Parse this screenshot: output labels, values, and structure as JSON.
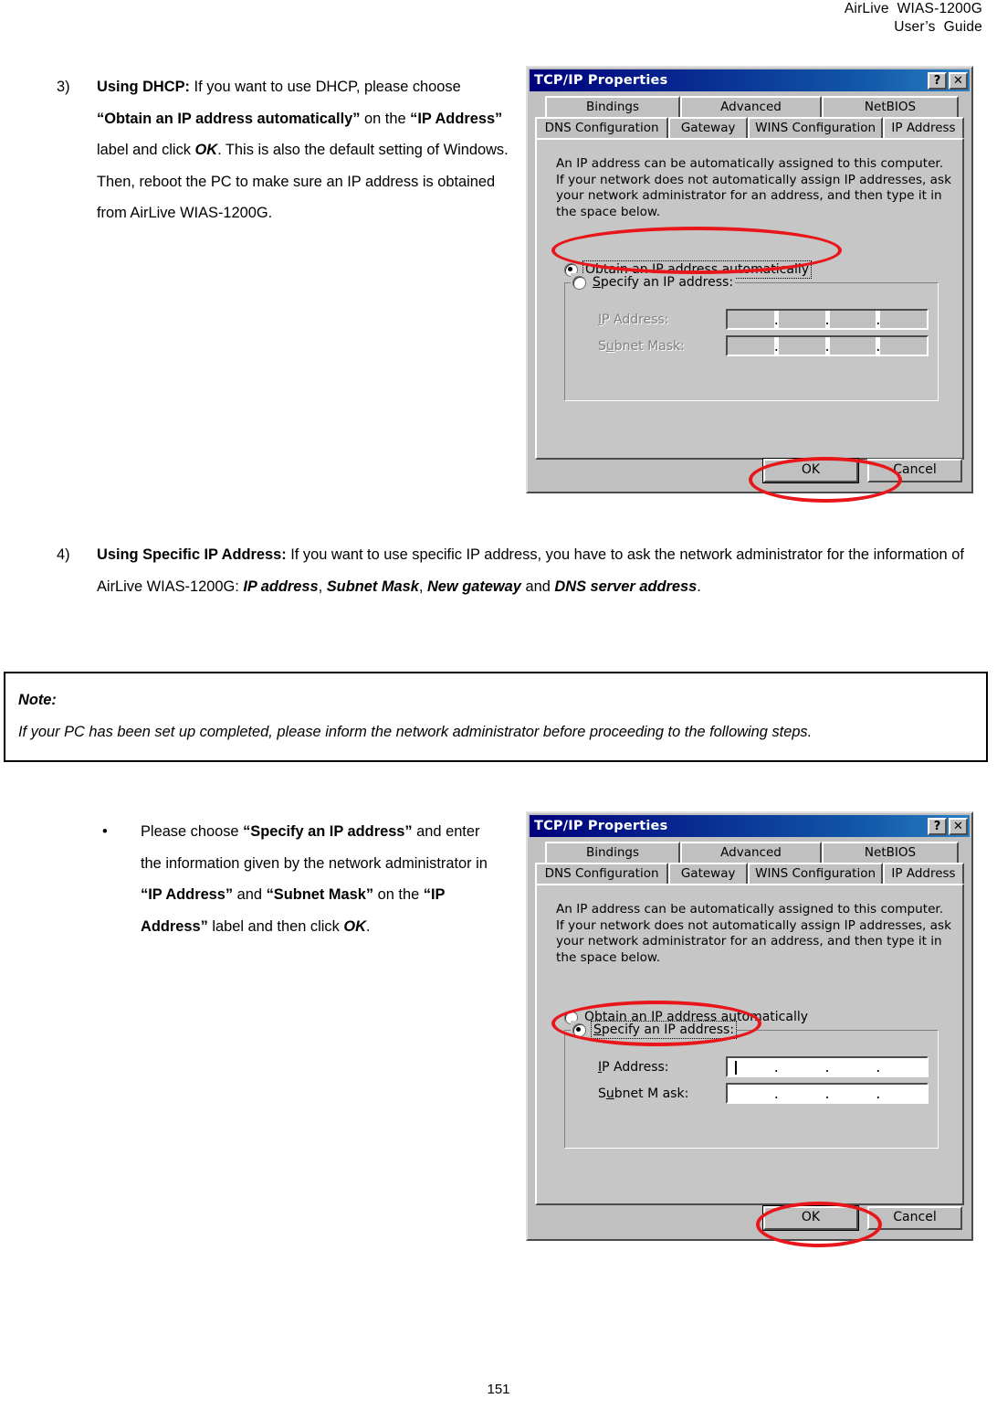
{
  "header": {
    "line1": "AirLive  WIAS-1200G",
    "line2": "User’s  Guide"
  },
  "page_number": "151",
  "item3": {
    "marker": "3)",
    "bold_lead": "Using DHCP:",
    "text_1": " If you want to use DHCP, please choose ",
    "bold_1": "“Obtain an IP address automatically”",
    "text_2": " on the ",
    "bold_2": "“IP Address”",
    "text_3": " label and click ",
    "bolditalic_1": "OK",
    "text_4": ". This is also the default setting of Windows. Then, reboot the PC to make sure an IP address is obtained from AirLive WIAS-1200G."
  },
  "item4": {
    "marker": "4)",
    "bold_lead": "Using Specific IP Address:",
    "text_1": " If you want to use specific IP address, you have to ask the network administrator for the information of AirLive WIAS-1200G: ",
    "bolditalic_1": "IP address",
    "sep_1": ", ",
    "bolditalic_2": "Subnet Mask",
    "sep_2": ", ",
    "bolditalic_3": "New gateway",
    "text_2": " and ",
    "bolditalic_4": "DNS server address",
    "text_3": "."
  },
  "note": {
    "title": "Note:",
    "text": "If your PC has been set up completed, please inform the network administrator before proceeding to the following steps."
  },
  "bullet": {
    "marker": "•",
    "text_1": "Please choose ",
    "bold_1": "“Specify an IP address”",
    "text_2": " and enter the information given by the network administrator in ",
    "bold_2": "“IP Address”",
    "text_3": " and ",
    "bold_3": "“Subnet Mask”",
    "text_4": " on the ",
    "bold_4": "“IP Address”",
    "text_5": " label and then click ",
    "bolditalic_1": "OK",
    "text_6": "."
  },
  "dialog1": {
    "title": "TCP/IP Properties",
    "help_button": "?",
    "close_button": "✕",
    "tabs_row1": [
      "Bindings",
      "Advanced",
      "NetBIOS"
    ],
    "tabs_row2": [
      "DNS Configuration",
      "Gateway",
      "WINS Configuration",
      "IP Address"
    ],
    "active_tab": "IP Address",
    "description": [
      "An IP address can be automatically assigned to this computer.",
      "If your network does not automatically assign IP addresses, ask",
      "your network administrator for an address, and then type it in",
      "the space below."
    ],
    "radio_obtain": "Obtain an IP address automatically",
    "radio_obtain_underline": "O",
    "radio_specify": "Specify an IP address:",
    "radio_specify_underline": "S",
    "selected_radio": "obtain",
    "ip_address_label": "IP Address:",
    "ip_address_underline": "I",
    "subnet_mask_label": "Subnet Mask:",
    "subnet_mask_underline": "u",
    "ip_address_value": "",
    "subnet_mask_value": "",
    "fields_enabled": false,
    "ok_button": "OK",
    "cancel_button": "Cancel",
    "annotations": [
      "obtain-radio-ellipse",
      "ok-button-ellipse"
    ]
  },
  "dialog2": {
    "title": "TCP/IP Properties",
    "help_button": "?",
    "close_button": "✕",
    "tabs_row1": [
      "Bindings",
      "Advanced",
      "NetBIOS"
    ],
    "tabs_row2": [
      "DNS Configuration",
      "Gateway",
      "WINS Configuration",
      "IP Address"
    ],
    "active_tab": "IP Address",
    "description": [
      "An IP address can be automatically assigned to this computer.",
      "If your network does not automatically assign IP addresses, ask",
      "your network administrator for an address, and then type it in",
      "the space below."
    ],
    "radio_obtain": "Obtain an IP address automatically",
    "radio_obtain_underline": "O",
    "radio_specify": "Specify an IP address:",
    "radio_specify_underline": "S",
    "selected_radio": "specify",
    "ip_address_label": "IP Address:",
    "ip_address_underline": "I",
    "subnet_mask_label": "Subnet M ask:",
    "subnet_mask_underline": "u",
    "ip_address_value": "",
    "subnet_mask_value": "",
    "fields_enabled": true,
    "ok_button": "OK",
    "cancel_button": "Cancel",
    "annotations": [
      "specify-radio-ellipse",
      "ok-button-ellipse"
    ]
  },
  "colors": {
    "annotation_red": "#e8161a",
    "titlebar_blue": "#00007c",
    "dialog_face": "#c0c0c0"
  }
}
